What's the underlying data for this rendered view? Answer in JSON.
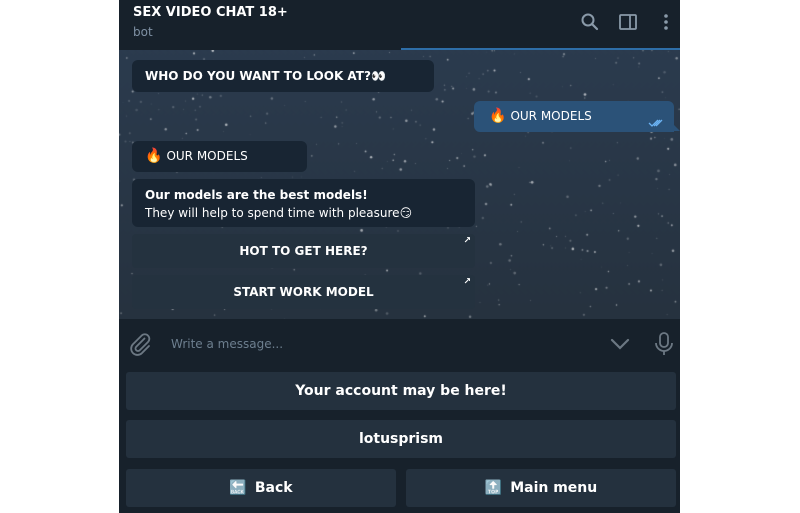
{
  "header": {
    "title": "SEX VIDEO CHAT 18+",
    "subtitle": "bot",
    "icons": [
      "search-icon",
      "sidebar-toggle-icon",
      "more-vertical-icon"
    ]
  },
  "messages": {
    "question": "WHO DO YOU WANT TO LOOK AT?👀",
    "outgoing": {
      "emoji": "🔥",
      "text": "OUR MODELS"
    },
    "models_title": {
      "emoji": "🔥",
      "text": "OUR MODELS"
    },
    "models_text_line1": "Our models are the best models!",
    "models_text_line2": "They will help to spend time with pleasure😏",
    "inline_buttons": [
      {
        "label": "HOT TO GET HERE?",
        "icon": "external-link-arrow"
      },
      {
        "label": "START WORK MODEL",
        "icon": "external-link-arrow"
      }
    ]
  },
  "input": {
    "placeholder": "Write a message..."
  },
  "keyboard": {
    "row1": "Your account may be here!",
    "row2": "lotusprism",
    "back": {
      "icon": "🔙",
      "label": "Back"
    },
    "main_menu": {
      "icon": "🔝",
      "label": "Main menu"
    }
  },
  "colors": {
    "app_bg": "#17212b",
    "chat_bg": "#2b3a4c",
    "incoming_bubble": "#182533",
    "outgoing_bubble": "#2b5278",
    "accent": "#4fa3e3"
  }
}
